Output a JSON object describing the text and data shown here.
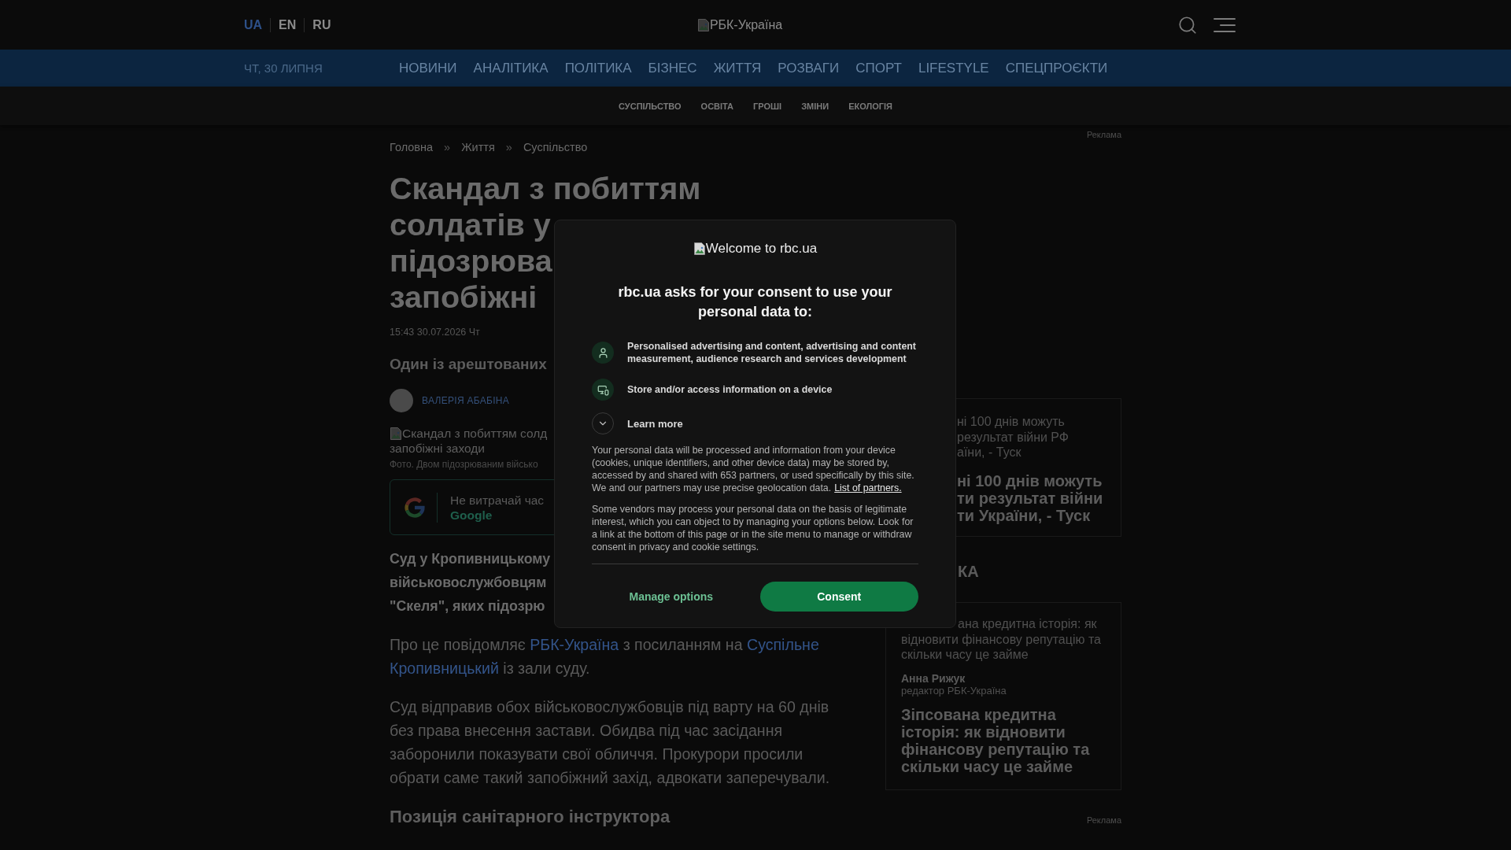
{
  "header": {
    "languages": [
      {
        "label": "UA",
        "selected": true
      },
      {
        "label": "EN",
        "selected": false
      },
      {
        "label": "RU",
        "selected": false
      }
    ],
    "logo_alt": "РБК-Україна"
  },
  "nav": {
    "date": "ЧТ, 30 ЛИПНЯ",
    "items": [
      "НОВИНИ",
      "АНАЛІТИКА",
      "ПОЛІТИКА",
      "БІЗНЕС",
      "ЖИТТЯ",
      "РОЗВАГИ",
      "СПОРТ",
      "LIFESTYLE",
      "СПЕЦПРОЄКТИ"
    ]
  },
  "subnav": [
    "СУСПІЛЬСТВО",
    "ОСВІТА",
    "ГРОШІ",
    "ЗМІНИ",
    "ЕКОЛОГІЯ"
  ],
  "breadcrumb": [
    {
      "kind": "link",
      "text": "Головна"
    },
    {
      "kind": "separator",
      "text": "»"
    },
    {
      "kind": "link",
      "text": "Життя"
    },
    {
      "kind": "separator",
      "text": "»"
    },
    {
      "kind": "link",
      "text": "Суспільство"
    }
  ],
  "article": {
    "title_lines": [
      "Скандал з побиттям",
      "солдатів у",
      "підозрюва",
      "запобіжні"
    ],
    "date": "15:43 30.07.2026 Чт",
    "subtitle": "Один із арештованих",
    "author": "ВАЛЕРІЯ АБАБІНА",
    "image_alt_lines": [
      "Скандал з побиттям солд",
      "запобіжні заходи"
    ],
    "caption": "Фото. Двом підозрюваним військо",
    "promo": {
      "text": "Не витрачай час",
      "link": "Google"
    },
    "lead_lines": [
      "Суд у Кропивницькому",
      "військовослужбовцям",
      "\"Скеля\", яких підозрю"
    ],
    "paragraphs": [
      {
        "parts": [
          {
            "kind": "text",
            "text": "Про це повідомляє "
          },
          {
            "kind": "link",
            "text": "РБК-Україна"
          },
          {
            "kind": "text",
            "text": " з посиланням на "
          },
          {
            "kind": "link",
            "text": "Суспільне Кропивницький"
          },
          {
            "kind": "text",
            "text": " із зали суду."
          }
        ]
      },
      {
        "parts": [
          {
            "kind": "text",
            "text": "Суд відправив обох військовослужбовців під варту на 60 днів без права внесення застави. Обидва під час засідання заборонили показувати свої обличчя. Прокурори просили обрати саме такий запобіжний захід, адвокати заперечували."
          }
        ]
      }
    ],
    "subheading": "Позиція санітарного інструктора"
  },
  "sidebar": {
    "top_ad_label": "Реклама",
    "news_card": {
      "teaser_lines": [
        "ні 100 днів можуть",
        "результат війни РФ",
        "аїни, - Туск"
      ],
      "headline_lines": [
        "ні 100 днів можуть",
        "ти результат війни",
        "ти України, - Туск"
      ]
    },
    "section_title": "КА",
    "analytics_card": {
      "teaser_lines": [
        "ана кредитна історія: як",
        "відновити фінансову репутацію та",
        "скільки часу це займе"
      ],
      "author": "Анна Рижук",
      "role": "редактор РБК-Україна",
      "headline": "Зіпсована кредитна історія: як відновити фінансову репутацію та скільки часу це займе"
    },
    "bottom_ad_label": "Реклама"
  },
  "modal": {
    "logo_alt": "Welcome to rbc.ua",
    "title": "rbc.ua asks for your consent to use your personal data to:",
    "purposes": [
      {
        "kind": "person",
        "text": "Personalised advertising and content, advertising and content measurement, audience research and services development"
      },
      {
        "kind": "device",
        "text": "Store and/or access information on a device"
      }
    ],
    "learn_more": {
      "label": "Learn more",
      "expanded": false
    },
    "notice": [
      {
        "text": "Your personal data will be processed and information from your device (cookies, unique identifiers, and other device data) may be stored by, accessed by and shared with 653 partners, or used specifically by this site. We and our partners may use precise geolocation data.",
        "link": "List of partners."
      },
      {
        "text": "Some vendors may process your personal data on the basis of legitimate interest, which you can object to by managing your options below. Look for a link at the bottom of this page or in the site menu to manage or withdraw consent in privacy and cookie settings."
      }
    ],
    "buttons": [
      {
        "kind": "secondary",
        "label": "Manage options"
      },
      {
        "kind": "primary",
        "label": "Consent"
      }
    ]
  }
}
